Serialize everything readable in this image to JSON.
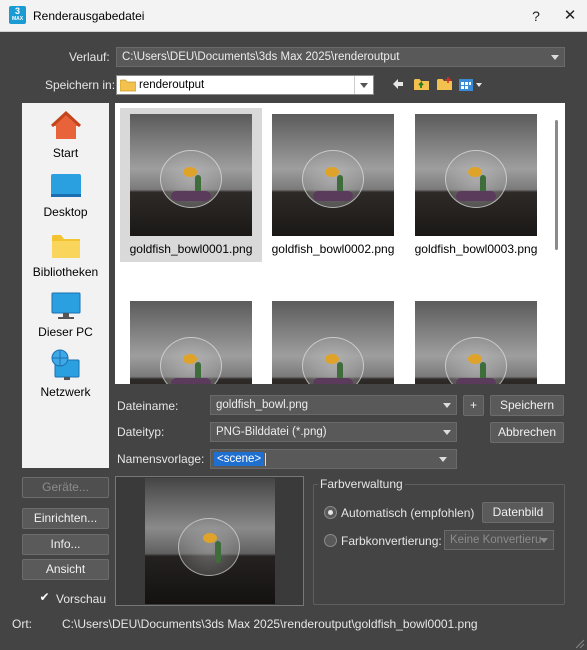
{
  "window": {
    "title": "Renderausgabedatei",
    "app_icon_text": "3",
    "app_icon_sub": "MAX",
    "help": "?",
    "close": "✕"
  },
  "history": {
    "label": "Verlauf:",
    "value": "C:\\Users\\DEU\\Documents\\3ds Max 2025\\renderoutput"
  },
  "save_in": {
    "label": "Speichern in:",
    "value": "renderoutput"
  },
  "toolbar": {
    "back_icon": "arrow-left-icon",
    "up_icon": "folder-up-icon",
    "new_folder_icon": "new-folder-icon",
    "view_icon": "view-menu-icon"
  },
  "places": [
    {
      "label": "Start",
      "icon": "home-icon"
    },
    {
      "label": "Desktop",
      "icon": "desktop-icon"
    },
    {
      "label": "Bibliotheken",
      "icon": "libraries-icon"
    },
    {
      "label": "Dieser PC",
      "icon": "pc-icon"
    },
    {
      "label": "Netzwerk",
      "icon": "network-icon"
    }
  ],
  "files": [
    {
      "name": "goldfish_bowl0001.png",
      "selected": true
    },
    {
      "name": "goldfish_bowl0002.png",
      "selected": false
    },
    {
      "name": "goldfish_bowl0003.png",
      "selected": false
    },
    {
      "name": "",
      "selected": false
    },
    {
      "name": "",
      "selected": false
    },
    {
      "name": "",
      "selected": false
    }
  ],
  "filename": {
    "label": "Dateiname:",
    "value": "goldfish_bowl.png",
    "plus": "+"
  },
  "filetype": {
    "label": "Dateityp:",
    "value": "PNG-Bilddatei (*.png)"
  },
  "name_template": {
    "label": "Namensvorlage:",
    "token": "<scene>"
  },
  "buttons": {
    "save": "Speichern",
    "cancel": "Abbrechen",
    "devices": "Geräte...",
    "setup": "Einrichten...",
    "info": "Info...",
    "view": "Ansicht",
    "data_image": "Datenbild"
  },
  "preview_checkbox": {
    "label": "Vorschau",
    "checked": true,
    "mark": "✔"
  },
  "color_management": {
    "title": "Farbverwaltung",
    "automatic": "Automatisch (empfohlen)",
    "conversion": "Farbkonvertierung:",
    "conversion_value": "Keine Konvertieru"
  },
  "location": {
    "label": "Ort:",
    "value": "C:\\Users\\DEU\\Documents\\3ds Max 2025\\renderoutput\\goldfish_bowl0001.png"
  }
}
